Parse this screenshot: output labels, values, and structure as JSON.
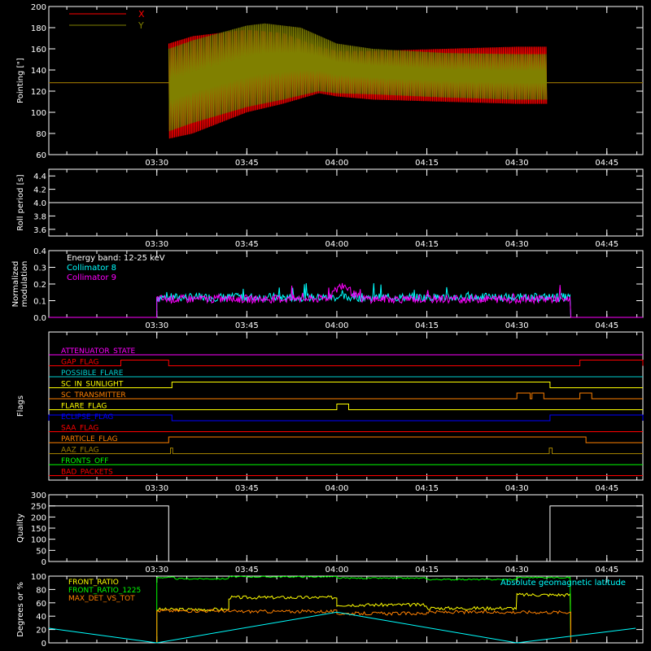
{
  "chart_data": [
    {
      "id": "pointing",
      "type": "line",
      "ylabel": "Pointing [\"]",
      "ylim": [
        60,
        200
      ],
      "yticks": [
        60,
        80,
        100,
        120,
        140,
        160,
        180,
        200
      ],
      "xtick_labels": [
        "03:30",
        "03:45",
        "04:00",
        "04:15",
        "04:30",
        "04:45"
      ],
      "legend_position": "top-left",
      "series": [
        {
          "name": "X",
          "color": "#ff0000",
          "baseline": 128,
          "active_start": "03:32",
          "active_end": "04:35",
          "upper_envelope": [
            [
              3.533,
              165
            ],
            [
              3.6,
              172
            ],
            [
              3.75,
              178
            ],
            [
              3.85,
              175
            ],
            [
              3.95,
              162
            ],
            [
              4.0,
              158
            ],
            [
              4.1,
              158
            ],
            [
              4.3,
              160
            ],
            [
              4.5,
              162
            ],
            [
              4.583,
              162
            ]
          ],
          "lower_envelope": [
            [
              3.533,
              75
            ],
            [
              3.6,
              80
            ],
            [
              3.75,
              100
            ],
            [
              3.85,
              108
            ],
            [
              3.95,
              118
            ],
            [
              4.0,
              115
            ],
            [
              4.1,
              112
            ],
            [
              4.3,
              110
            ],
            [
              4.5,
              108
            ],
            [
              4.583,
              108
            ]
          ]
        },
        {
          "name": "Y",
          "color": "#808000",
          "baseline": 128,
          "active_start": "03:32",
          "active_end": "04:35",
          "upper_envelope": [
            [
              3.533,
              160
            ],
            [
              3.6,
              168
            ],
            [
              3.75,
              182
            ],
            [
              3.8,
              184
            ],
            [
              3.9,
              180
            ],
            [
              4.0,
              165
            ],
            [
              4.1,
              160
            ],
            [
              4.3,
              156
            ],
            [
              4.5,
              155
            ],
            [
              4.583,
              155
            ]
          ],
          "lower_envelope": [
            [
              3.533,
              82
            ],
            [
              3.6,
              90
            ],
            [
              3.75,
              105
            ],
            [
              3.85,
              112
            ],
            [
              3.95,
              120
            ],
            [
              4.0,
              118
            ],
            [
              4.1,
              117
            ],
            [
              4.3,
              114
            ],
            [
              4.5,
              112
            ],
            [
              4.583,
              112
            ]
          ]
        }
      ]
    },
    {
      "id": "roll",
      "type": "line",
      "ylabel": "Roll period [s]",
      "ylim": [
        3.5,
        4.5
      ],
      "yticks": [
        3.6,
        3.8,
        4.0,
        4.2,
        4.4
      ],
      "ytick_labels": [
        "3.6",
        "3.8",
        "4.0",
        "4.2",
        "4.4"
      ],
      "xtick_labels": [
        "03:30",
        "03:45",
        "04:00",
        "04:15",
        "04:30",
        "04:45"
      ],
      "series": [
        {
          "color": "#ffffff",
          "constant": 4.0
        }
      ]
    },
    {
      "id": "modulation",
      "type": "line",
      "ylabel_lines": [
        "Normalized",
        "modulation"
      ],
      "ylim": [
        0,
        0.4
      ],
      "yticks": [
        0.0,
        0.1,
        0.2,
        0.3,
        0.4
      ],
      "ytick_labels": [
        "0.0",
        "0.1",
        "0.2",
        "0.3",
        "0.4"
      ],
      "xtick_labels": [
        "03:30",
        "03:45",
        "04:00",
        "04:15",
        "04:30",
        "04:45"
      ],
      "legend_title": "Energy band: 12-25 keV",
      "series": [
        {
          "name": "Collimator 8",
          "color": "#00ffff",
          "level": 0.12,
          "active_start": "03:30",
          "active_end": "04:39"
        },
        {
          "name": "Collimator 9",
          "color": "#ff00ff",
          "level": 0.11,
          "active_start": "03:30",
          "active_end": "04:39",
          "bump_center": "04:01",
          "bump_peak": 0.19
        }
      ]
    },
    {
      "id": "flags",
      "type": "line",
      "ylabel": "Flags",
      "xtick_labels": [
        "03:30",
        "03:45",
        "04:00",
        "04:15",
        "04:30",
        "04:45"
      ],
      "series": [
        {
          "name": "ATTENUATOR_STATE",
          "color": "#ff00ff",
          "segments": []
        },
        {
          "name": "GAP_FLAG",
          "color": "#ff0000",
          "segments": [
            [
              3.4,
              3.533
            ],
            [
              4.675,
              4.85
            ]
          ]
        },
        {
          "name": "POSSIBLE_FLARE",
          "color": "#00d0d0",
          "segments": []
        },
        {
          "name": "SC_IN_SUNLIGHT",
          "color": "#ffff00",
          "segments": [
            [
              3.542,
              4.592
            ]
          ]
        },
        {
          "name": "SC_TRANSMITTER",
          "color": "#ff8000",
          "segments": [
            [
              4.5,
              4.537
            ],
            [
              4.542,
              4.575
            ],
            [
              4.675,
              4.708
            ]
          ]
        },
        {
          "name": "FLARE_FLAG",
          "color": "#ffff00",
          "segments": [
            [
              4.0,
              4.033
            ]
          ]
        },
        {
          "name": "ECLIPSE_FLAG",
          "color": "#0000ff",
          "segments": [
            [
              3.2,
              3.542
            ],
            [
              4.592,
              4.85
            ]
          ]
        },
        {
          "name": "SAA_FLAG",
          "color": "#ff0000",
          "segments": []
        },
        {
          "name": "PARTICLE_FLAG",
          "color": "#ff8000",
          "segments": [
            [
              3.533,
              4.692
            ]
          ]
        },
        {
          "name": "AAZ_FLAG",
          "color": "#a08000",
          "segments": [
            [
              3.538,
              3.544
            ],
            [
              4.59,
              4.598
            ]
          ]
        },
        {
          "name": "FRONTS_OFF",
          "color": "#00ff00",
          "segments": []
        },
        {
          "name": "BAD_PACKETS",
          "color": "#ff0000",
          "segments": []
        }
      ]
    },
    {
      "id": "quality",
      "type": "line",
      "ylabel": "Quality",
      "ylim": [
        0,
        300
      ],
      "yticks": [
        0,
        50,
        100,
        150,
        200,
        250,
        300
      ],
      "xtick_labels": [
        "03:30",
        "03:45",
        "04:00",
        "04:15",
        "04:30",
        "04:45"
      ],
      "series": [
        {
          "color": "#ffffff",
          "segments": [
            [
              3.2,
              3.533,
              250
            ],
            [
              3.533,
              4.592,
              0
            ],
            [
              4.592,
              4.85,
              250
            ]
          ]
        }
      ]
    },
    {
      "id": "ratios",
      "type": "line",
      "ylabel": "Degrees or %",
      "ylim": [
        0,
        100
      ],
      "yticks": [
        0,
        20,
        40,
        60,
        80,
        100
      ],
      "series": [
        {
          "name": "FRONT_RATIO",
          "color": "#ffff00",
          "steps": [
            [
              3.5,
              3.7,
              50
            ],
            [
              3.7,
              4.0,
              68
            ],
            [
              4.0,
              4.25,
              57
            ],
            [
              4.25,
              4.5,
              52
            ],
            [
              4.5,
              4.65,
              72
            ]
          ]
        },
        {
          "name": "FRONT_RATIO_1225",
          "color": "#00ff00",
          "steps": [
            [
              3.5,
              3.55,
              98
            ],
            [
              3.55,
              3.7,
              96
            ],
            [
              3.7,
              4.0,
              99
            ],
            [
              4.0,
              4.25,
              97
            ],
            [
              4.25,
              4.5,
              95
            ],
            [
              4.5,
              4.65,
              98
            ]
          ]
        },
        {
          "name": "MAX_DET_VS_TOT",
          "color": "#ff8000",
          "steps": [
            [
              3.5,
              3.7,
              48
            ],
            [
              3.7,
              4.0,
              47
            ],
            [
              4.0,
              4.25,
              44
            ],
            [
              4.25,
              4.65,
              46
            ]
          ]
        },
        {
          "name": "Absolute geomagnetic latitude",
          "color": "#00ffff",
          "vpoints": [
            [
              3.2,
              22
            ],
            [
              3.5,
              0
            ],
            [
              4.0,
              46
            ],
            [
              4.5,
              0
            ],
            [
              4.83,
              22
            ]
          ]
        }
      ]
    }
  ]
}
